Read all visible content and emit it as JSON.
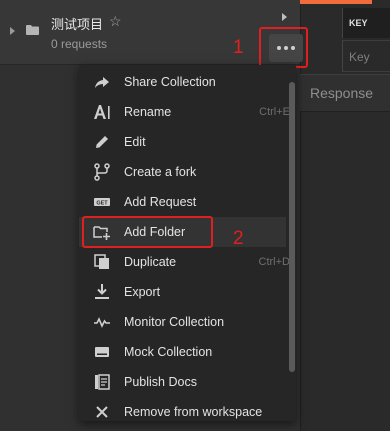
{
  "collection": {
    "name": "测试项目",
    "subtitle": "0 requests"
  },
  "right_panel": {
    "key_header": "KEY",
    "key_placeholder": "Key",
    "response_label": "Response"
  },
  "callouts": [
    "1",
    "2"
  ],
  "menu": {
    "items": [
      {
        "label": "Share Collection",
        "shortcut": ""
      },
      {
        "label": "Rename",
        "shortcut": "Ctrl+E"
      },
      {
        "label": "Edit",
        "shortcut": ""
      },
      {
        "label": "Create a fork",
        "shortcut": ""
      },
      {
        "label": "Add Request",
        "shortcut": ""
      },
      {
        "label": "Add Folder",
        "shortcut": ""
      },
      {
        "label": "Duplicate",
        "shortcut": "Ctrl+D"
      },
      {
        "label": "Export",
        "shortcut": ""
      },
      {
        "label": "Monitor Collection",
        "shortcut": ""
      },
      {
        "label": "Mock Collection",
        "shortcut": ""
      },
      {
        "label": "Publish Docs",
        "shortcut": ""
      },
      {
        "label": "Remove from workspace",
        "shortcut": ""
      }
    ]
  },
  "colors": {
    "accent": "#f26b3a",
    "callout": "#e02020"
  }
}
